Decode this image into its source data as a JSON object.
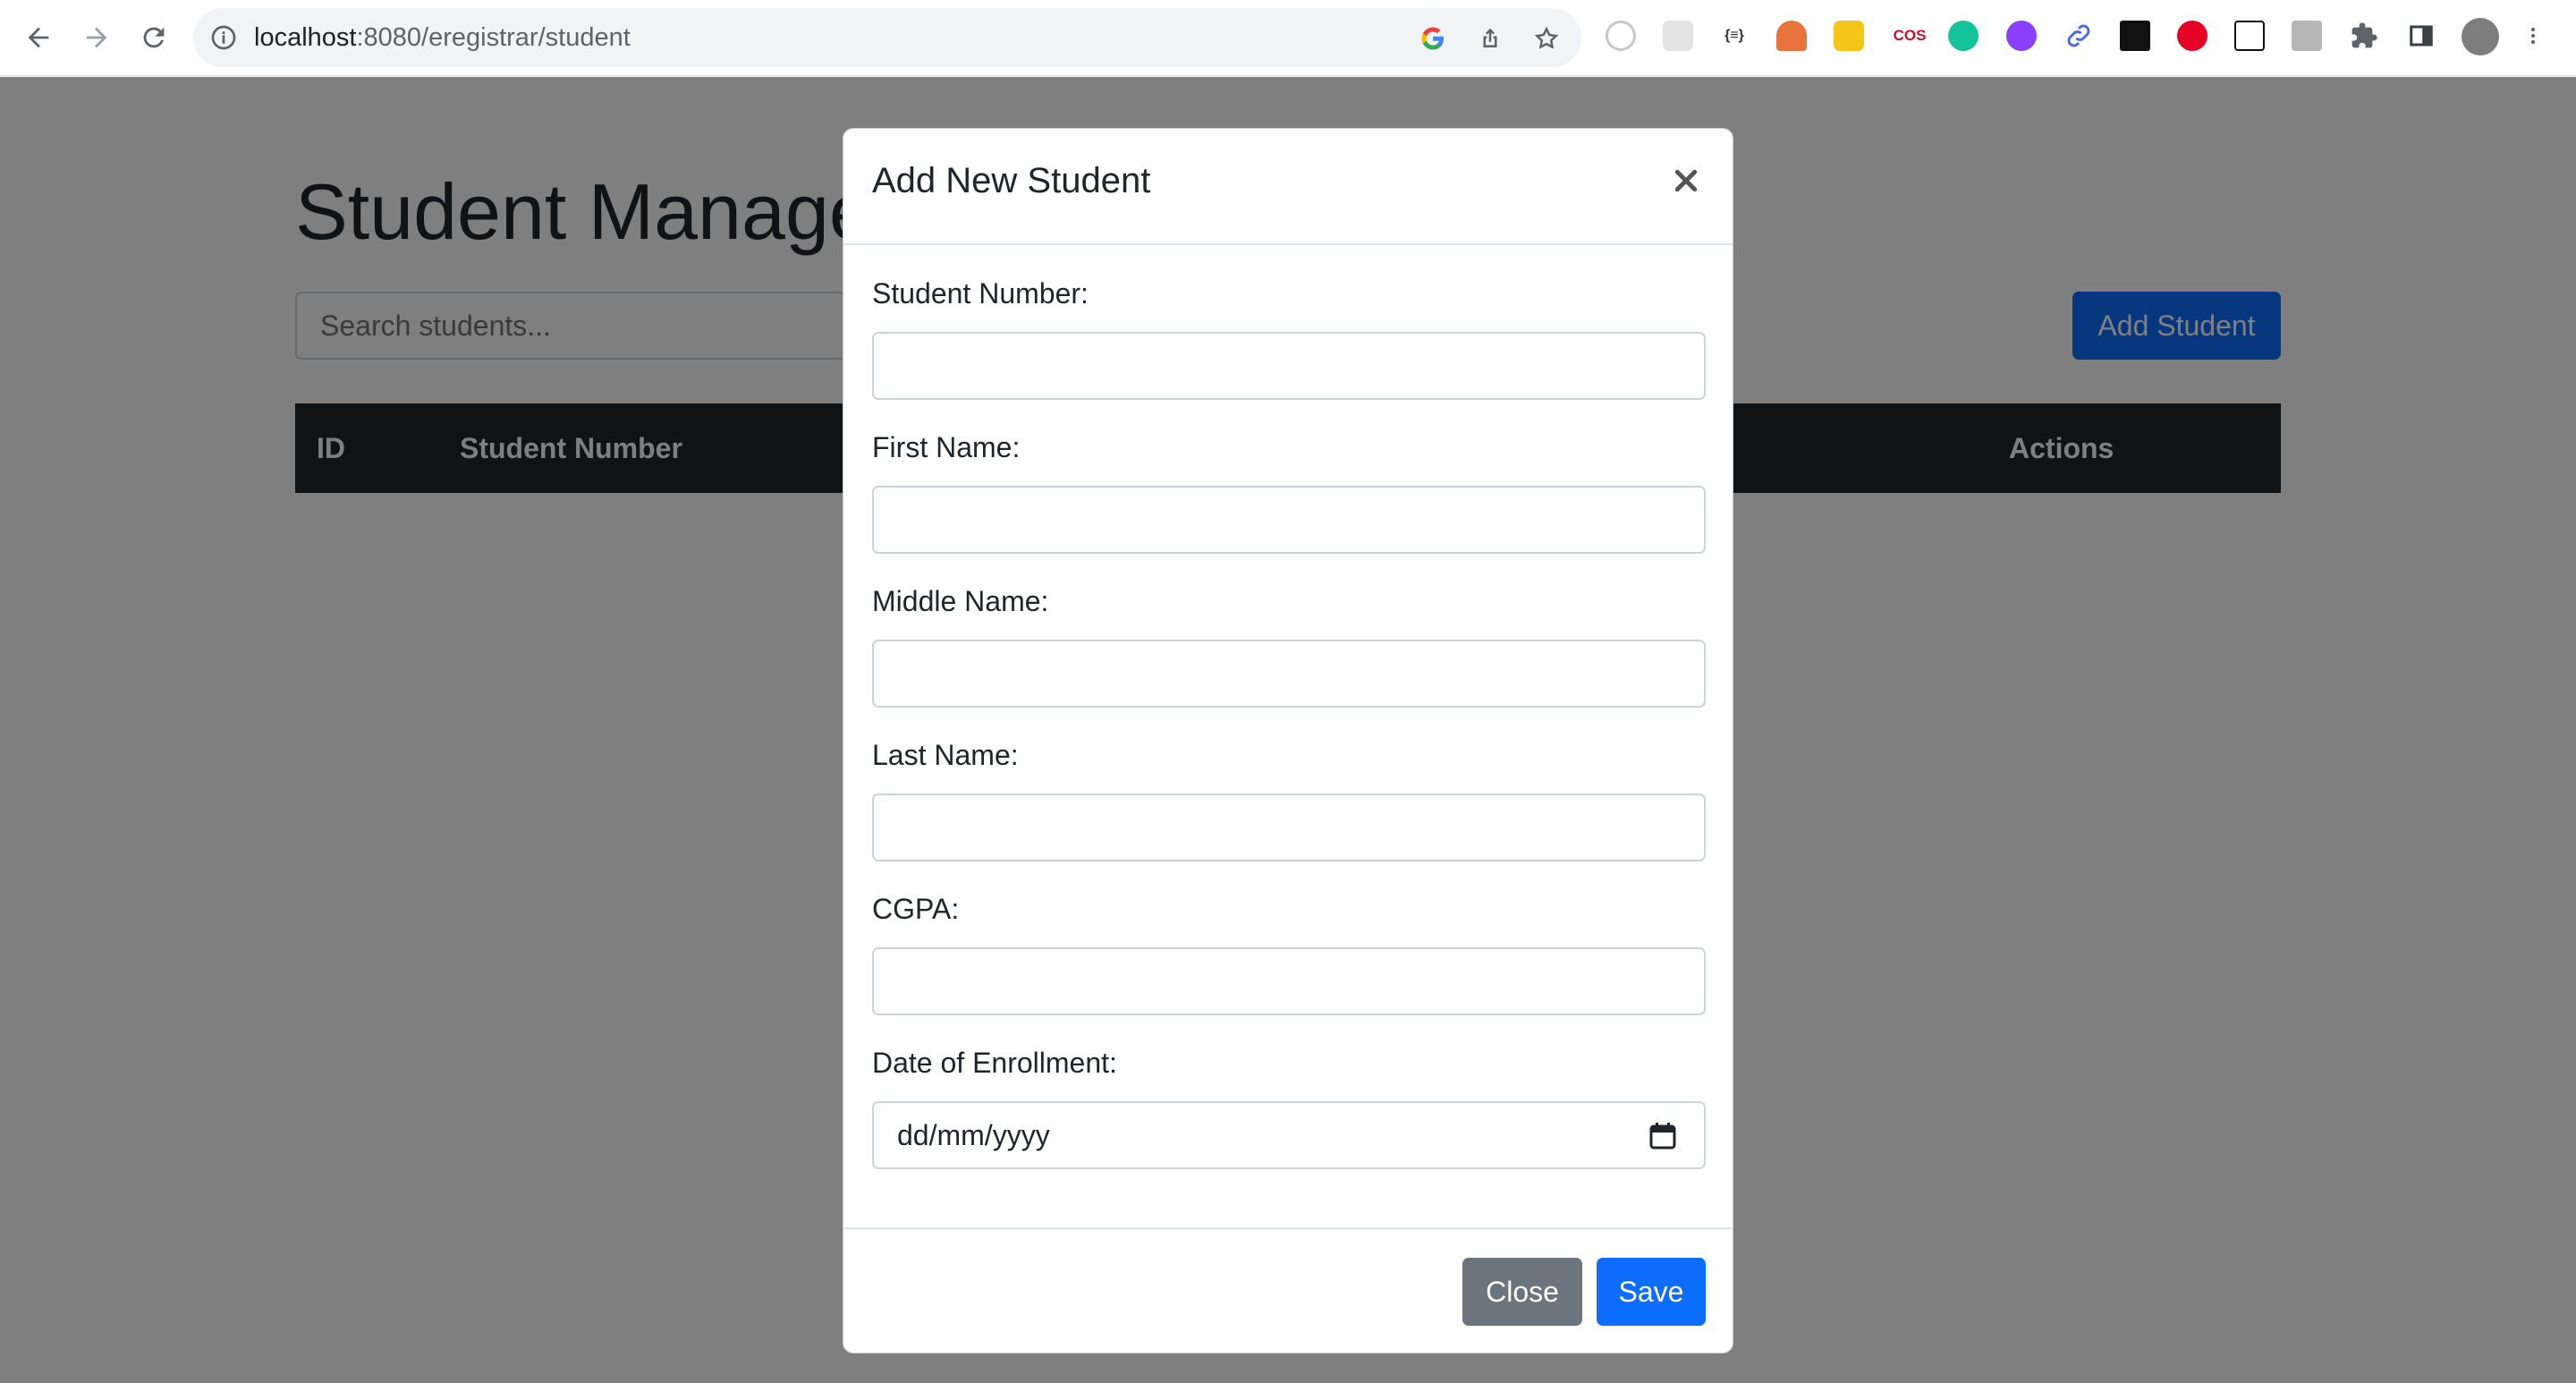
{
  "browser": {
    "url_host": "localhost",
    "url_path": ":8080/eregistrar/student"
  },
  "page": {
    "title": "Student Management",
    "search_placeholder": "Search students...",
    "add_button_label": "Add Student",
    "table_headers": {
      "id": "ID",
      "student_number": "Student Number",
      "actions": "Actions"
    }
  },
  "modal": {
    "title": "Add New Student",
    "close_symbol": "×",
    "fields": [
      {
        "label": "Student Number:",
        "value": ""
      },
      {
        "label": "First Name:",
        "value": ""
      },
      {
        "label": "Middle Name:",
        "value": ""
      },
      {
        "label": "Last Name:",
        "value": ""
      },
      {
        "label": "CGPA:",
        "value": ""
      },
      {
        "label": "Date of Enrollment:",
        "placeholder": "dd/mm/yyyy"
      }
    ],
    "close_button_label": "Close",
    "save_button_label": "Save"
  },
  "colors": {
    "primary": "#0d6efd",
    "secondary": "#6c757d",
    "table_header": "#212529"
  },
  "extensions": [
    "ext-timer",
    "ext-grid",
    "ext-json",
    "ext-figure",
    "ext-bulb",
    "ext-cos",
    "ext-grammarly",
    "ext-purple",
    "ext-link",
    "ext-lh",
    "ext-pinterest",
    "ext-notion",
    "ext-photo",
    "extensions-puzzle-icon",
    "sidebar-icon",
    "profile-avatar",
    "menu-kebab-icon"
  ]
}
